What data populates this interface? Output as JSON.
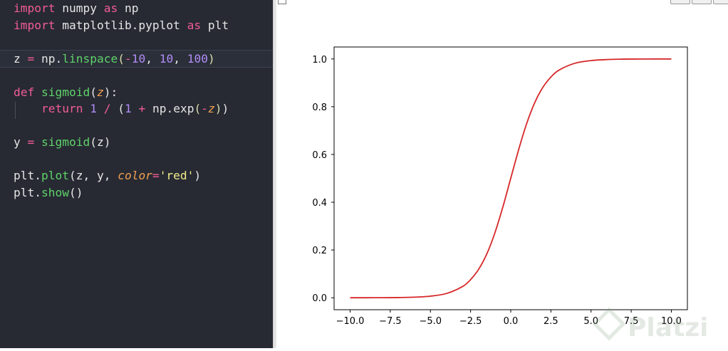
{
  "editor": {
    "lines": [
      [
        [
          "kw",
          "import"
        ],
        [
          "plain",
          " numpy "
        ],
        [
          "kw",
          "as"
        ],
        [
          "plain",
          " np"
        ]
      ],
      [
        [
          "kw",
          "import"
        ],
        [
          "plain",
          " matplotlib.pyplot "
        ],
        [
          "kw",
          "as"
        ],
        [
          "plain",
          " plt"
        ]
      ],
      [],
      [
        [
          "plain",
          "z "
        ],
        [
          "op",
          "="
        ],
        [
          "plain",
          " np."
        ],
        [
          "fn",
          "linspace"
        ],
        [
          "par",
          "("
        ],
        [
          "op",
          "-"
        ],
        [
          "num",
          "10"
        ],
        [
          "plain",
          ", "
        ],
        [
          "num",
          "10"
        ],
        [
          "plain",
          ", "
        ],
        [
          "num",
          "100"
        ],
        [
          "par",
          ")"
        ]
      ],
      [],
      [
        [
          "kw",
          "def"
        ],
        [
          "plain",
          " "
        ],
        [
          "fn",
          "sigmoid"
        ],
        [
          "plain",
          "("
        ],
        [
          "param",
          "z"
        ],
        [
          "plain",
          "):"
        ]
      ],
      [
        [
          "plain",
          "    "
        ],
        [
          "kw",
          "return"
        ],
        [
          "plain",
          " "
        ],
        [
          "num",
          "1"
        ],
        [
          "plain",
          " "
        ],
        [
          "op",
          "/"
        ],
        [
          "plain",
          " ("
        ],
        [
          "num",
          "1"
        ],
        [
          "plain",
          " "
        ],
        [
          "op",
          "+"
        ],
        [
          "plain",
          " np.exp"
        ],
        [
          "par",
          "("
        ],
        [
          "op",
          "-"
        ],
        [
          "param",
          "z"
        ],
        [
          "par",
          ")"
        ],
        [
          "plain",
          ")"
        ]
      ],
      [],
      [
        [
          "plain",
          "y "
        ],
        [
          "op",
          "="
        ],
        [
          "plain",
          " "
        ],
        [
          "fn",
          "sigmoid"
        ],
        [
          "plain",
          "(z)"
        ]
      ],
      [],
      [
        [
          "plain",
          "plt."
        ],
        [
          "fn",
          "plot"
        ],
        [
          "plain",
          "(z, y, "
        ],
        [
          "param",
          "color"
        ],
        [
          "op",
          "="
        ],
        [
          "str",
          "'red'"
        ],
        [
          "plain",
          ")"
        ]
      ],
      [
        [
          "plain",
          "plt."
        ],
        [
          "fn",
          "show"
        ],
        [
          "plain",
          "()"
        ]
      ]
    ]
  },
  "watermark": "Platzi",
  "chart_data": {
    "type": "line",
    "title": "",
    "xlabel": "",
    "ylabel": "",
    "xlim": [
      -11,
      11
    ],
    "ylim": [
      -0.05,
      1.05
    ],
    "xticks": [
      -10.0,
      -7.5,
      -5.0,
      -2.5,
      0.0,
      2.5,
      5.0,
      7.5,
      10.0
    ],
    "xtick_labels": [
      "−10.0",
      "−7.5",
      "−5.0",
      "−2.5",
      "0.0",
      "2.5",
      "5.0",
      "7.5",
      "10.0"
    ],
    "yticks": [
      0.0,
      0.2,
      0.4,
      0.6,
      0.8,
      1.0
    ],
    "ytick_labels": [
      "0.0",
      "0.2",
      "0.4",
      "0.6",
      "0.8",
      "1.0"
    ],
    "grid": false,
    "series": [
      {
        "color": "#d62728",
        "x": [
          -10,
          -9,
          -8,
          -7,
          -6,
          -5,
          -4,
          -3,
          -2.5,
          -2,
          -1.5,
          -1,
          -0.5,
          0,
          0.5,
          1,
          1.5,
          2,
          2.5,
          3,
          4,
          5,
          6,
          7,
          8,
          9,
          10
        ],
        "y": [
          5e-05,
          0.00012,
          0.00034,
          0.0009,
          0.0025,
          0.0067,
          0.018,
          0.047,
          0.076,
          0.119,
          0.182,
          0.269,
          0.378,
          0.5,
          0.622,
          0.731,
          0.818,
          0.881,
          0.924,
          0.953,
          0.982,
          0.993,
          0.9975,
          0.9991,
          0.99966,
          0.99988,
          0.99995
        ]
      }
    ]
  }
}
